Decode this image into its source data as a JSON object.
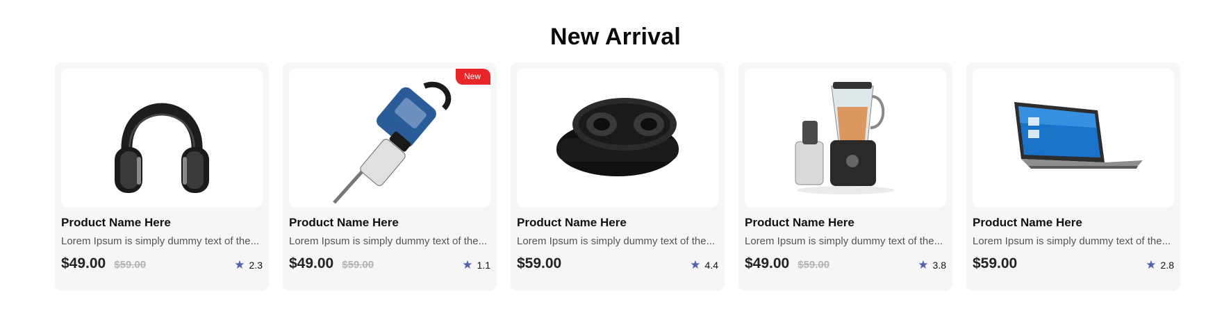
{
  "section": {
    "title": "New Arrival"
  },
  "products": [
    {
      "image": "headphones-image",
      "badge": "",
      "name": "Product Name Here",
      "description": "Lorem Ipsum is simply dummy text of the...",
      "price": "$49.00",
      "old_price": "$59.00",
      "rating": "2.3"
    },
    {
      "image": "jackhammer-image",
      "badge": "New",
      "name": "Product Name Here",
      "description": "Lorem Ipsum is simply dummy text of the...",
      "price": "$49.00",
      "old_price": "$59.00",
      "rating": "1.1"
    },
    {
      "image": "earbuds-case-image",
      "badge": "",
      "name": "Product Name Here",
      "description": "Lorem Ipsum is simply dummy text of the...",
      "price": "$59.00",
      "old_price": "",
      "rating": "4.4"
    },
    {
      "image": "blender-image",
      "badge": "",
      "name": "Product Name Here",
      "description": "Lorem Ipsum is simply dummy text of the...",
      "price": "$49.00",
      "old_price": "$59.00",
      "rating": "3.8"
    },
    {
      "image": "laptop-image",
      "badge": "",
      "name": "Product Name Here",
      "description": "Lorem Ipsum is simply dummy text of the...",
      "price": "$59.00",
      "old_price": "",
      "rating": "2.8"
    }
  ],
  "icons": {
    "rating": "star-icon"
  },
  "colors": {
    "badge": "#e8262a",
    "star": "#4f5fa8",
    "card_bg": "#f6f6f6"
  }
}
